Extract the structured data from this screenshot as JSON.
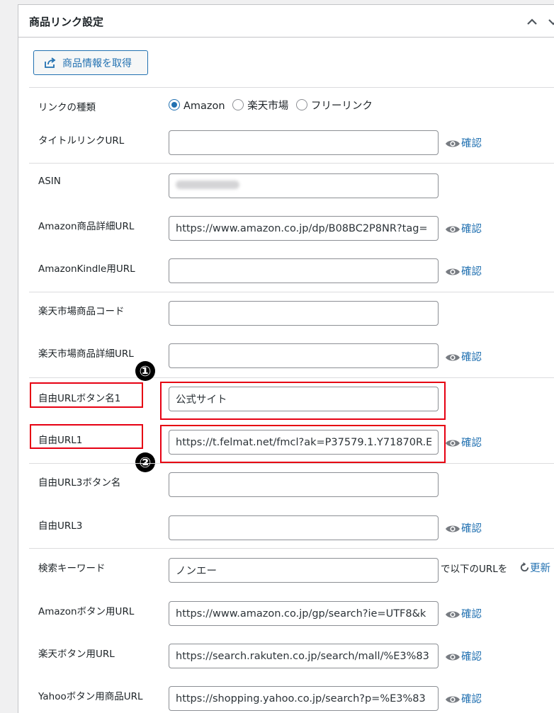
{
  "panel": {
    "title": "商品リンク設定"
  },
  "fetch_button": {
    "label": "商品情報を取得"
  },
  "link_type": {
    "label": "リンクの種類",
    "options": [
      "Amazon",
      "楽天市場",
      "フリーリンク"
    ],
    "selected": "Amazon"
  },
  "fields": {
    "title_link_url": {
      "label": "タイトルリンクURL",
      "value": ""
    },
    "asin": {
      "label": "ASIN",
      "value": ""
    },
    "amazon_detail_url": {
      "label": "Amazon商品詳細URL",
      "value": "https://www.amazon.co.jp/dp/B08BC2P8NR?tag="
    },
    "kindle_url": {
      "label": "AmazonKindle用URL",
      "value": ""
    },
    "rakuten_code": {
      "label": "楽天市場商品コード",
      "value": ""
    },
    "rakuten_detail_url": {
      "label": "楽天市場商品詳細URL",
      "value": ""
    },
    "free_button_name1": {
      "label": "自由URLボタン名1",
      "value": "公式サイト"
    },
    "free_url1": {
      "label": "自由URL1",
      "value": "https://t.felmat.net/fmcl?ak=P37579.1.Y71870R.E"
    },
    "free_button_name3": {
      "label": "自由URL3ボタン名",
      "value": ""
    },
    "free_url3": {
      "label": "自由URL3",
      "value": ""
    },
    "search_keyword": {
      "label": "検索キーワード",
      "value": "ノンエー",
      "suffix": "で以下のURLを",
      "refresh": "更新"
    },
    "amazon_button_url": {
      "label": "Amazonボタン用URL",
      "value": "https://www.amazon.co.jp/gp/search?ie=UTF8&k"
    },
    "rakuten_button_url": {
      "label": "楽天ボタン用URL",
      "value": "https://search.rakuten.co.jp/search/mall/%E3%83"
    },
    "yahoo_button_url": {
      "label": "Yahooボタン用商品URL",
      "value": "https://shopping.yahoo.co.jp/search?p=%E3%83"
    }
  },
  "confirm_label": "確認",
  "markers": [
    "①",
    "②"
  ],
  "colors": {
    "accent": "#2271b1",
    "highlight": "#e60012"
  }
}
